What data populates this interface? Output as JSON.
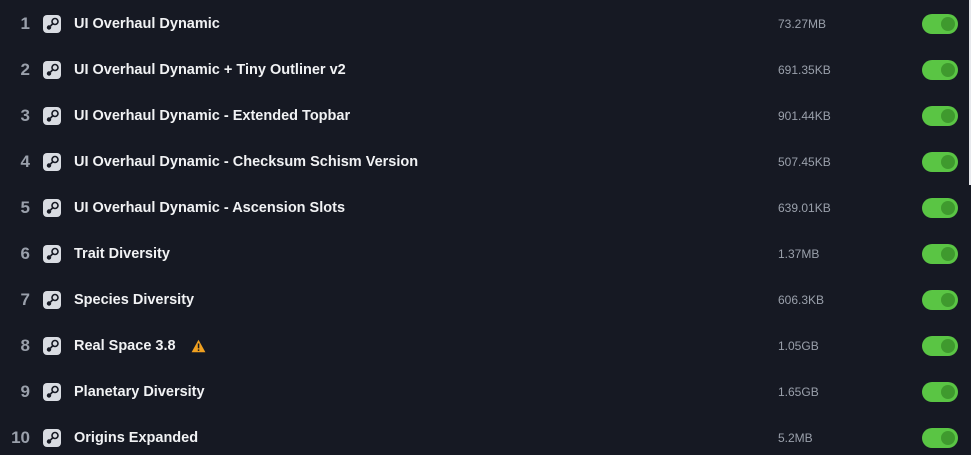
{
  "mods": [
    {
      "index": "1",
      "name": "UI Overhaul Dynamic",
      "size": "73.27MB",
      "enabled": true,
      "warning": false,
      "icon": "steam-icon"
    },
    {
      "index": "2",
      "name": "UI Overhaul Dynamic + Tiny Outliner v2",
      "size": "691.35KB",
      "enabled": true,
      "warning": false,
      "icon": "steam-icon"
    },
    {
      "index": "3",
      "name": "UI Overhaul Dynamic - Extended Topbar",
      "size": "901.44KB",
      "enabled": true,
      "warning": false,
      "icon": "steam-icon"
    },
    {
      "index": "4",
      "name": "UI Overhaul Dynamic - Checksum Schism Version",
      "size": "507.45KB",
      "enabled": true,
      "warning": false,
      "icon": "steam-icon"
    },
    {
      "index": "5",
      "name": "UI Overhaul Dynamic - Ascension Slots",
      "size": "639.01KB",
      "enabled": true,
      "warning": false,
      "icon": "steam-icon"
    },
    {
      "index": "6",
      "name": "Trait Diversity",
      "size": "1.37MB",
      "enabled": true,
      "warning": false,
      "icon": "steam-icon"
    },
    {
      "index": "7",
      "name": "Species Diversity",
      "size": "606.3KB",
      "enabled": true,
      "warning": false,
      "icon": "steam-icon"
    },
    {
      "index": "8",
      "name": "Real Space 3.8",
      "size": "1.05GB",
      "enabled": true,
      "warning": true,
      "icon": "steam-icon"
    },
    {
      "index": "9",
      "name": "Planetary Diversity",
      "size": "1.65GB",
      "enabled": true,
      "warning": false,
      "icon": "steam-icon"
    },
    {
      "index": "10",
      "name": "Origins Expanded",
      "size": "5.2MB",
      "enabled": true,
      "warning": false,
      "icon": "steam-icon"
    }
  ],
  "colors": {
    "background": "#161923",
    "toggle_on": "#5ac544",
    "warning": "#f0a020"
  }
}
